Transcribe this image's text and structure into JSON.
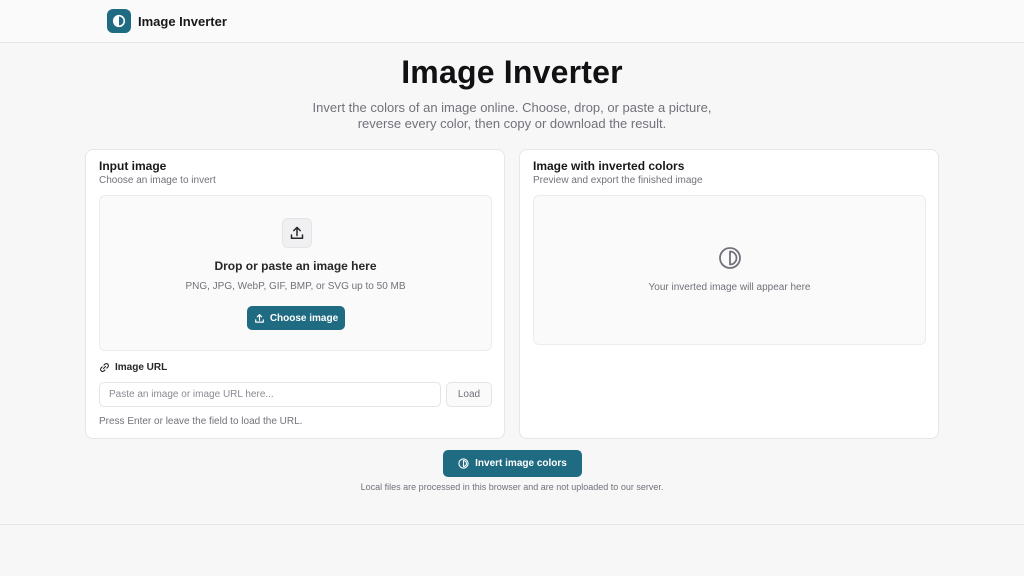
{
  "app": {
    "name": "Image Inverter",
    "logo_icon": "half-circle-contrast-icon",
    "accent_color": "#1f6b82"
  },
  "hero": {
    "title": "Image Inverter",
    "subtitle": "Invert the colors of an image online. Choose, drop, or paste a picture, reverse every color, then copy or download the result."
  },
  "input_card": {
    "title": "Input image",
    "description": "Choose an image to invert",
    "dropzone": {
      "icon": "upload-icon",
      "title": "Drop or paste an image here",
      "hint": "PNG, JPG, WebP, GIF, BMP, or SVG up to 50 MB",
      "choose_label": "Choose image"
    },
    "url": {
      "icon": "link-icon",
      "label": "Image URL",
      "placeholder": "Paste an image or image URL here...",
      "value": "",
      "load_label": "Load",
      "help": "Press Enter or leave the field to load the URL."
    }
  },
  "output_card": {
    "title": "Image with inverted colors",
    "description": "Preview and export the finished image",
    "placeholder_icon": "invert-circle-icon",
    "placeholder_text": "Your inverted image will appear here"
  },
  "actions": {
    "invert_label": "Invert image colors",
    "privacy_note": "Local files are processed in this browser and are not uploaded to our server."
  }
}
